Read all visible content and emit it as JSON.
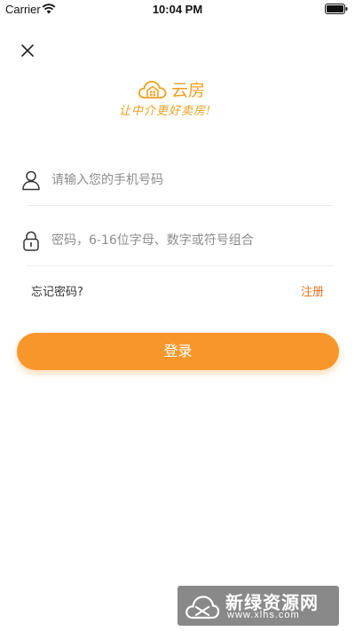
{
  "status_bar": {
    "carrier": "Carrier",
    "time": "10:04 PM"
  },
  "logo": {
    "name": "云房",
    "slogan": "让中介更好卖房!"
  },
  "login_form": {
    "phone_placeholder": "请输入您的手机号码",
    "password_placeholder": "密码，6-16位字母、数字或符号组合",
    "forgot_password": "忘记密码?",
    "register": "注册",
    "login_button": "登录"
  },
  "watermark": {
    "title": "新绿资源网",
    "url": "www.xlhs.com"
  },
  "colors": {
    "accent": "#f7972b",
    "link": "#e8711e",
    "logo": "#f0a020"
  }
}
